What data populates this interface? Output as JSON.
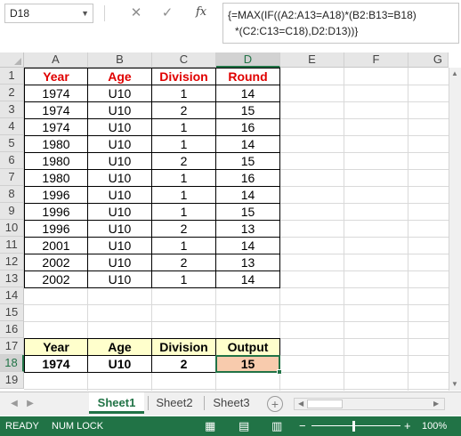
{
  "formula_bar": {
    "name_box": "D18",
    "cancel_icon": "✕",
    "enter_icon": "✓",
    "fx_label": "fx",
    "formula_line1": "{=MAX(IF((A2:A13=A18)*(B2:B13=B18)",
    "formula_line2": "*(C2:C13=C18),D2:D13))}"
  },
  "columns": [
    "A",
    "B",
    "C",
    "D",
    "E",
    "F",
    "G"
  ],
  "rows": [
    "1",
    "2",
    "3",
    "4",
    "5",
    "6",
    "7",
    "8",
    "9",
    "10",
    "11",
    "12",
    "13",
    "14",
    "15",
    "16",
    "17",
    "18",
    "19"
  ],
  "table": {
    "headers": [
      "Year",
      "Age",
      "Division",
      "Round"
    ],
    "data": [
      [
        "1974",
        "U10",
        "1",
        "14"
      ],
      [
        "1974",
        "U10",
        "2",
        "15"
      ],
      [
        "1974",
        "U10",
        "1",
        "16"
      ],
      [
        "1980",
        "U10",
        "1",
        "14"
      ],
      [
        "1980",
        "U10",
        "2",
        "15"
      ],
      [
        "1980",
        "U10",
        "1",
        "16"
      ],
      [
        "1996",
        "U10",
        "1",
        "14"
      ],
      [
        "1996",
        "U10",
        "1",
        "15"
      ],
      [
        "1996",
        "U10",
        "2",
        "13"
      ],
      [
        "2001",
        "U10",
        "1",
        "14"
      ],
      [
        "2002",
        "U10",
        "2",
        "13"
      ],
      [
        "2002",
        "U10",
        "1",
        "14"
      ]
    ]
  },
  "lookup": {
    "headers": [
      "Year",
      "Age",
      "Division",
      "Output"
    ],
    "values": [
      "1974",
      "U10",
      "2",
      "15"
    ]
  },
  "sheet_tabs": [
    "Sheet1",
    "Sheet2",
    "Sheet3"
  ],
  "active_sheet": "Sheet1",
  "status_bar": {
    "ready": "READY",
    "num_lock": "NUM LOCK",
    "zoom": "100%"
  },
  "colors": {
    "accent": "#217346",
    "header_text": "#e00000",
    "lookup_fill": "#ffffcc",
    "output_fill": "#f8cbad"
  }
}
